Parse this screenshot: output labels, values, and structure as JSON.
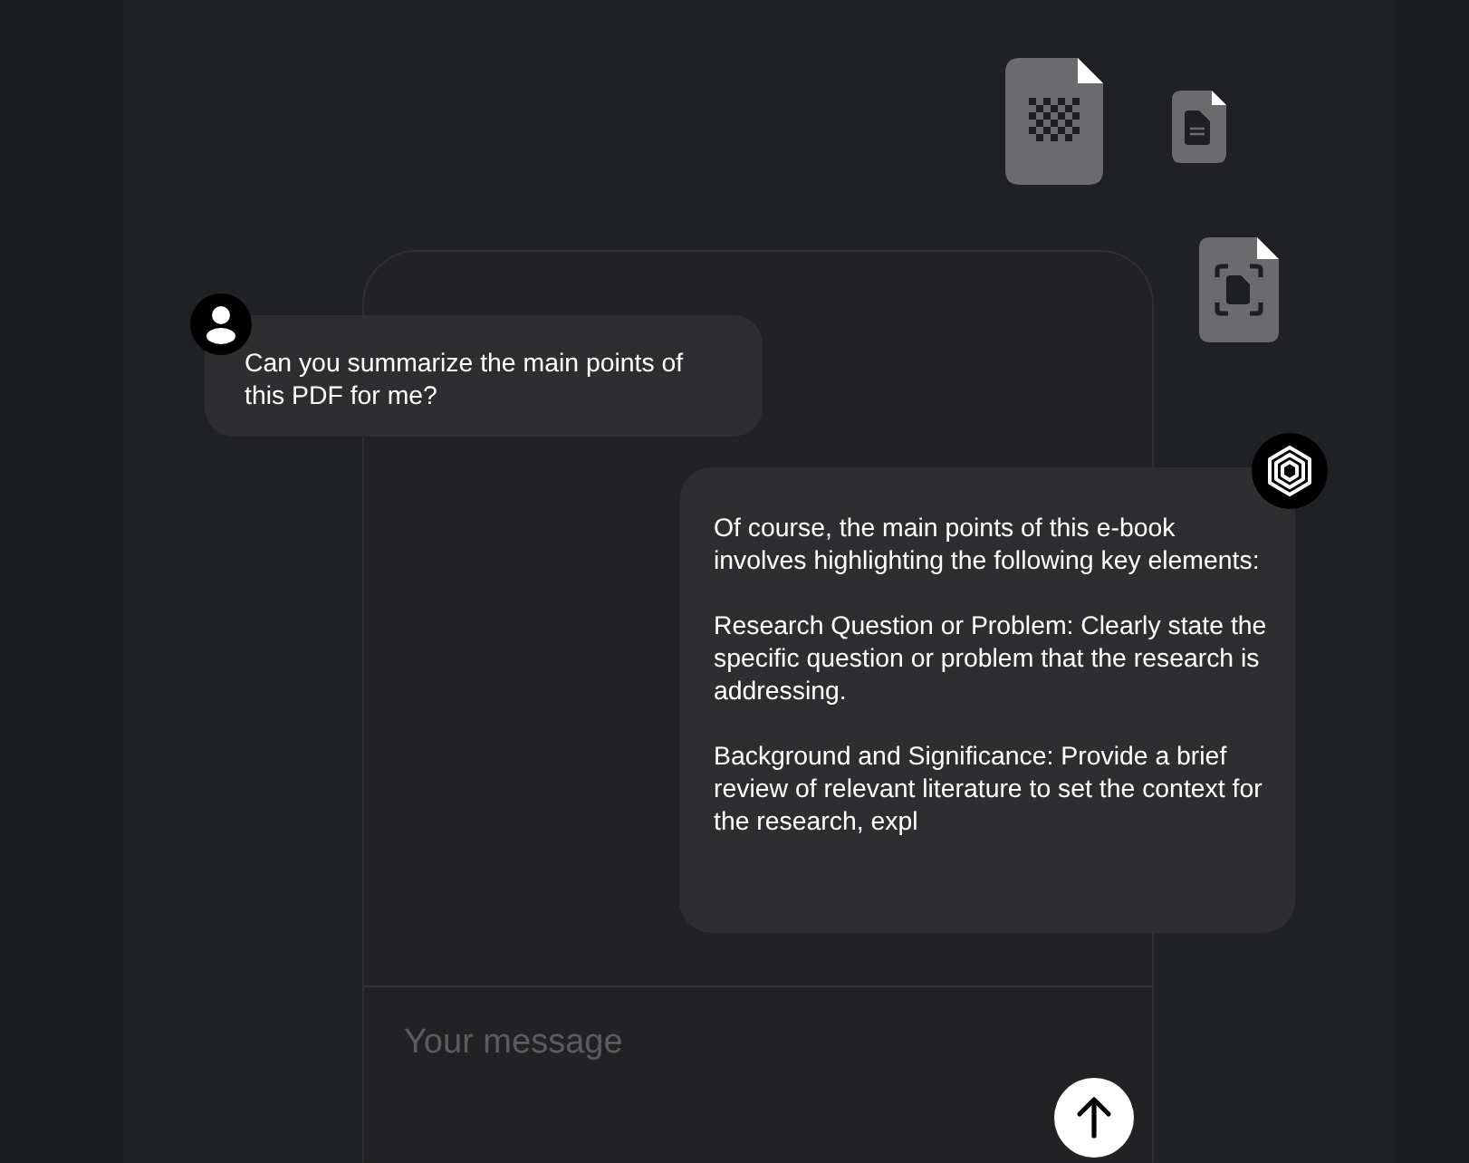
{
  "messages": [
    {
      "kind": "user",
      "paragraphs": [
        "Can you summarize the main points of\nthis PDF for me?"
      ]
    },
    {
      "kind": "assistant",
      "paragraphs": [
        "Of course, the main points of this e-book\ninvolves highlighting the following key elements:",
        "Research Question or Problem: Clearly state the\nspecific question or problem that the research is\naddressing.",
        "Background and Significance: Provide a brief\nreview of relevant literature to set the context for\nthe research, expl"
      ]
    }
  ],
  "composer": {
    "placeholder": "Your message"
  }
}
